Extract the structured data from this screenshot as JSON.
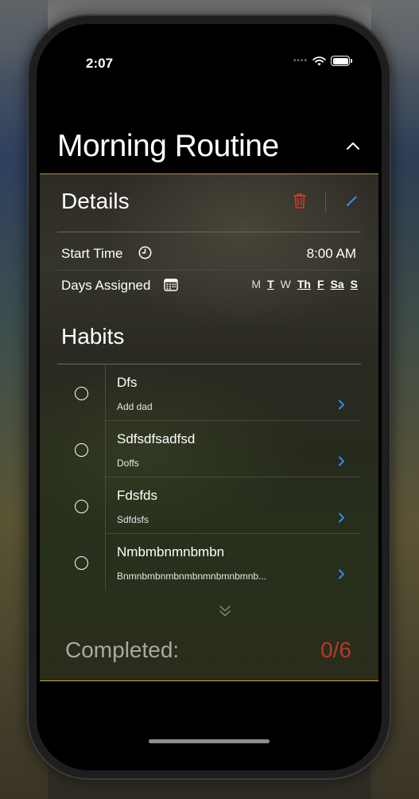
{
  "status_bar": {
    "time": "2:07",
    "signal": "••••"
  },
  "routine": {
    "title": "Morning Routine"
  },
  "details": {
    "title": "Details",
    "start_time_label": "Start Time",
    "start_time_value": "8:00 AM",
    "days_label": "Days Assigned",
    "days": [
      {
        "label": "M",
        "active": false
      },
      {
        "label": "T",
        "active": true
      },
      {
        "label": "W",
        "active": false
      },
      {
        "label": "Th",
        "active": true
      },
      {
        "label": "F",
        "active": true
      },
      {
        "label": "Sa",
        "active": true
      },
      {
        "label": "S",
        "active": true
      }
    ]
  },
  "habits": {
    "title": "Habits",
    "items": [
      {
        "name": "Dfs",
        "description": "Add dad"
      },
      {
        "name": "Sdfsdfsadfsd",
        "description": "Doffs"
      },
      {
        "name": "Fdsfds",
        "description": "Sdfdsfs"
      },
      {
        "name": "Nmbmbnmnbmbn",
        "description": "Bnmnbmbnmbnmbnmnbmnbmnb..."
      }
    ]
  },
  "completion": {
    "label": "Completed:",
    "value": "0/6"
  },
  "colors": {
    "accent_blue": "#2f8cf0",
    "delete_red": "#d9382a",
    "gold_border": "#c9a24a",
    "completed_red": "#b33a2a"
  },
  "icons": {
    "delete": "trash-icon",
    "edit": "pencil-icon",
    "start_time": "clock-icon",
    "days": "calendar-icon",
    "collapse": "chevron-up-icon",
    "habit_detail": "chevron-right-icon",
    "expand": "double-chevron-down-icon"
  }
}
